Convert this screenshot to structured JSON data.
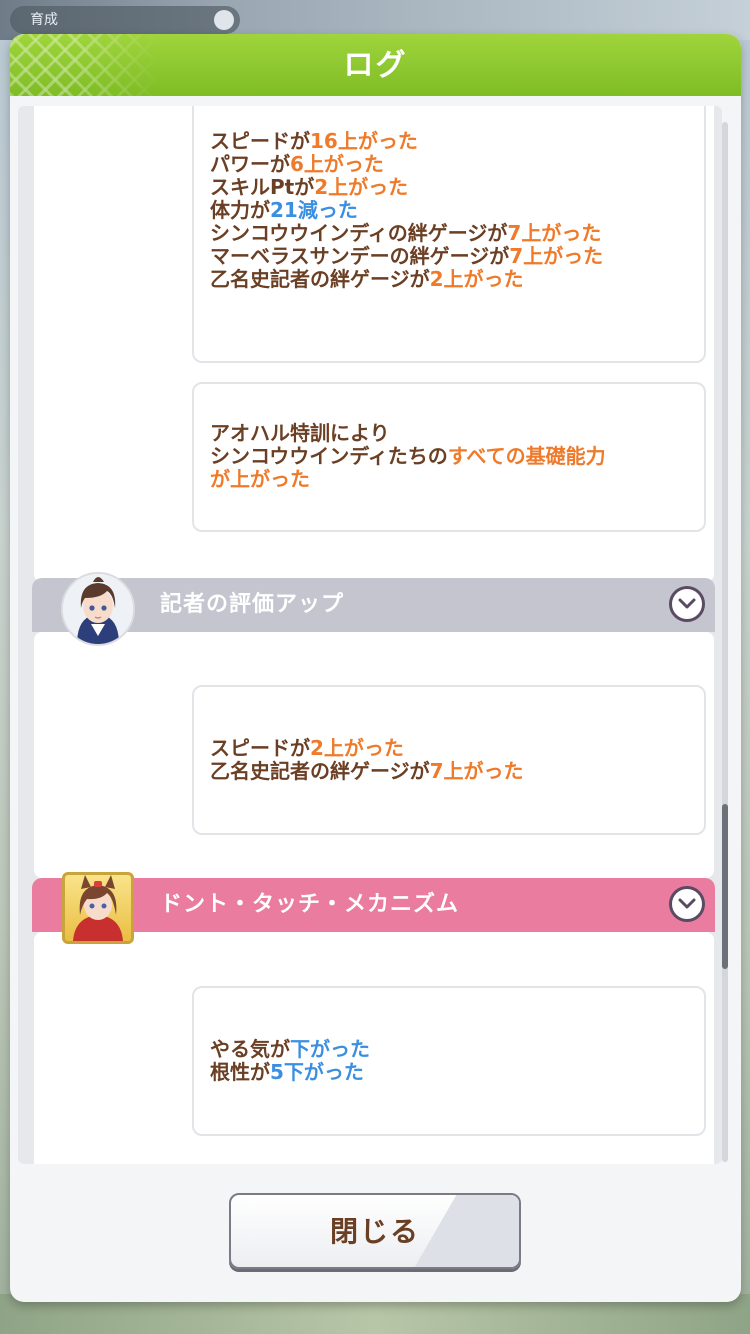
{
  "background": {
    "top_label": "育成"
  },
  "dialog": {
    "title": "ログ",
    "close_label": "閉じる"
  },
  "groups": [
    {
      "cards": [
        {
          "lines": [
            [
              {
                "t": "スピードが"
              },
              {
                "t": "16上がった",
                "c": "o"
              }
            ],
            [
              {
                "t": "パワーが"
              },
              {
                "t": "6上がった",
                "c": "o"
              }
            ],
            [
              {
                "t": "スキルPtが"
              },
              {
                "t": "2上がった",
                "c": "o"
              }
            ],
            [
              {
                "t": "体力が"
              },
              {
                "t": "21減った",
                "c": "b"
              }
            ],
            [
              {
                "t": "シンコウウインディの絆ゲージが"
              },
              {
                "t": "7上がった",
                "c": "o"
              }
            ],
            [
              {
                "t": "マーベラスサンデーの絆ゲージが"
              },
              {
                "t": "7上がった",
                "c": "o"
              }
            ],
            [
              {
                "t": "乙名史記者の絆ゲージが"
              },
              {
                "t": "2上がった",
                "c": "o"
              }
            ]
          ]
        },
        {
          "lines": [
            [
              {
                "t": "アオハル特訓により"
              }
            ],
            [
              {
                "t": "シンコウウインディたちの"
              },
              {
                "t": "すべての基礎能力",
                "c": "o"
              }
            ],
            [
              {
                "t": "が上がった",
                "c": "o"
              }
            ]
          ]
        }
      ]
    },
    {
      "header": "記者の評価アップ",
      "avatar": "reporter-avatar",
      "cards": [
        {
          "lines": [
            [
              {
                "t": "スピードが"
              },
              {
                "t": "2上がった",
                "c": "o"
              }
            ],
            [
              {
                "t": "乙名史記者の絆ゲージが"
              },
              {
                "t": "7上がった",
                "c": "o"
              }
            ]
          ]
        }
      ]
    },
    {
      "header": "ドント・タッチ・メカニズム",
      "avatar": "horse-girl-avatar",
      "cards": [
        {
          "lines": [
            [
              {
                "t": "やる気が"
              },
              {
                "t": "下がった",
                "c": "b"
              }
            ],
            [
              {
                "t": "根性が"
              },
              {
                "t": "5下がった",
                "c": "b"
              }
            ]
          ]
        }
      ]
    }
  ],
  "colors": {
    "title_green": "#8ccb2e",
    "text_brown": "#6b3f24",
    "up_orange": "#ee7a2a",
    "down_blue": "#3b8fe0",
    "header_gray": "#c4c5cf",
    "header_pink": "#ea7ca0"
  },
  "icons": [
    "chevron-down-icon",
    "reporter-avatar",
    "horse-girl-avatar"
  ]
}
